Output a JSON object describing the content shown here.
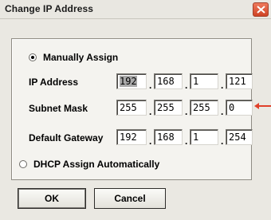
{
  "window": {
    "title": "Change IP Address"
  },
  "mode": {
    "manual_label": "Manually Assign",
    "dhcp_label": "DHCP Assign Automatically",
    "selected": "manual"
  },
  "fields": {
    "ip_address": {
      "label": "IP Address",
      "octets": [
        "192",
        "168",
        "1",
        "121"
      ]
    },
    "subnet_mask": {
      "label": "Subnet Mask",
      "octets": [
        "255",
        "255",
        "255",
        "0"
      ]
    },
    "default_gateway": {
      "label": "Default Gateway",
      "octets": [
        "192",
        "168",
        "1",
        "254"
      ]
    },
    "separator": "."
  },
  "buttons": {
    "ok_label": "OK",
    "cancel_label": "Cancel"
  },
  "icons": {
    "close": "close-icon"
  },
  "colors": {
    "accent": "#e0402a"
  }
}
